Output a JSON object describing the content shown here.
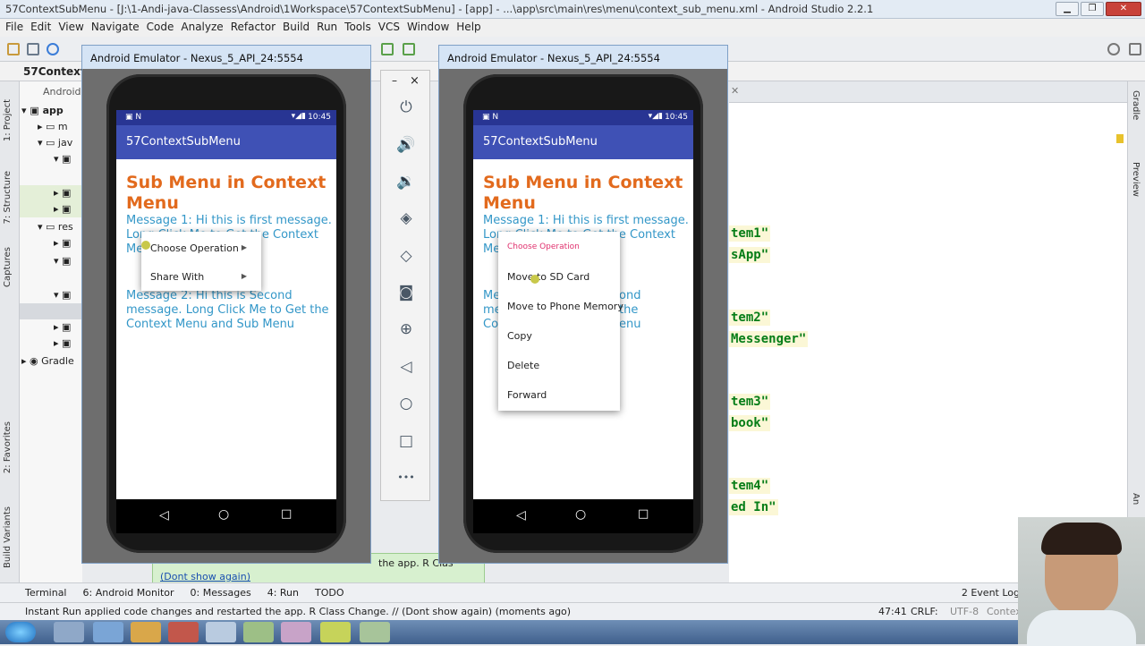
{
  "ide": {
    "title": "57ContextSubMenu - [J:\\1-Andi-java-Classess\\Android\\1Workspace\\57ContextSubMenu] - [app] - ...\\app\\src\\main\\res\\menu\\context_sub_menu.xml - Android Studio 2.2.1",
    "menus": [
      "File",
      "Edit",
      "View",
      "Navigate",
      "Code",
      "Analyze",
      "Refactor",
      "Build",
      "Run",
      "Tools",
      "VCS",
      "Window",
      "Help"
    ],
    "breadcrumb": "57ContextSu",
    "project_view": "Android",
    "tree": {
      "app": "app",
      "m": "m",
      "jav": "jav",
      "res": "res",
      "gradle": "Gradle"
    },
    "left_tools": {
      "project": "1: Project",
      "structure": "7: Structure",
      "captures": "Captures",
      "favorites": "2: Favorites",
      "build_variants": "Build Variants"
    },
    "right_tools": {
      "gradle": "Gradle",
      "preview": "Preview",
      "an": "An"
    },
    "code_lines": [
      {
        "text": "tem1\""
      },
      {
        "text": "sApp\""
      },
      {
        "text": "tem2\""
      },
      {
        "text": " Messenger\""
      },
      {
        "text": "tem3\""
      },
      {
        "text": "book\""
      },
      {
        "text": "tem4\""
      },
      {
        "text": "ed In\""
      }
    ],
    "balloon": {
      "text": "the app. R Clas",
      "link": "(Dont show again)"
    },
    "bottom_tools": [
      "Terminal",
      "6: Android Monitor",
      "0: Messages",
      "4: Run",
      "TODO"
    ],
    "event_log": "2  Event Log",
    "status": {
      "message": "Instant Run applied code changes and restarted the app. R Class Change. // (Dont show again) (moments ago)",
      "pos": "47:41",
      "crlf": "CRLF:",
      "enc": "UTF-8",
      "ctx": "Contex"
    }
  },
  "emulators": [
    {
      "title": "Android Emulator - Nexus_5_API_24:5554",
      "time": "10:45",
      "app_title": "57ContextSubMenu",
      "heading": "Sub Menu in Context Menu",
      "msg1": "Message 1: Hi this is first message. Long Click Me to Get the Context Me",
      "msg2": "Message 2: Hi this is Second message. Long Click Me to Get the Context Menu and Sub Menu",
      "menu": {
        "item1": "Choose Operation",
        "item2": "Share With"
      }
    },
    {
      "title": "Android Emulator - Nexus_5_API_24:5554",
      "time": "10:45",
      "app_title": "57ContextSubMenu",
      "heading": "Sub Menu in Context Menu",
      "msg1": "Message 1: Hi this is first message. Long Click Me to Get the Context Me",
      "msg2a": "Me",
      "msg2b": "me",
      "msg2c": "Co",
      "msg2d": "ond",
      "msg2e": "the",
      "msg2f": "enu",
      "submenu": {
        "header": "Choose Operation",
        "items": [
          "Move to SD Card",
          "Move to Phone Memory",
          "Copy",
          "Delete",
          "Forward"
        ],
        "header_color": "#e0316e"
      }
    }
  ],
  "emulator_controls": {
    "minimize": "–",
    "close": "×",
    "more": "•••"
  },
  "colors": {
    "status_bar": "#283593",
    "app_bar": "#3f51b5",
    "heading": "#e26a1d",
    "message": "#3397c8"
  }
}
